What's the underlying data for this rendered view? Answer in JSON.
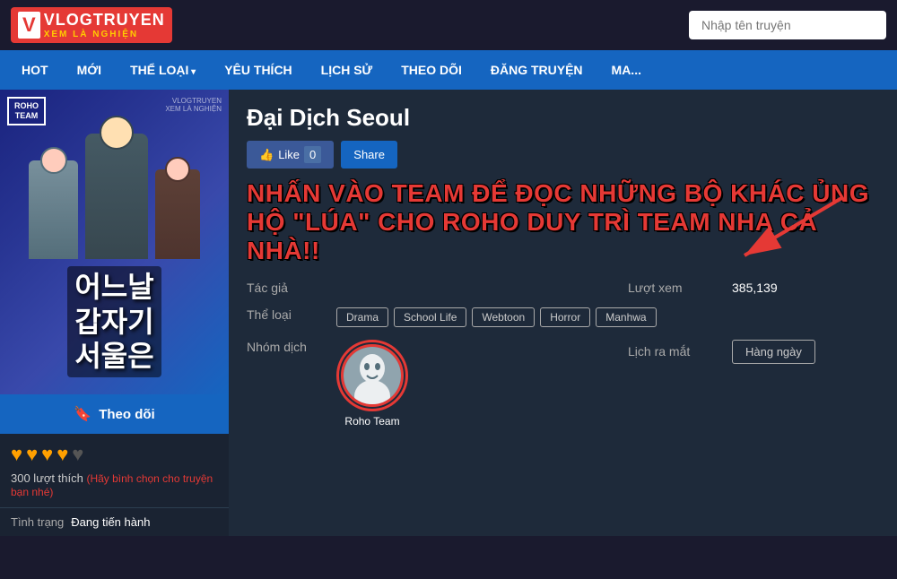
{
  "header": {
    "logo_v": "V",
    "logo_title": "VLOGTRUYEN",
    "logo_sub": "XEM LÀ NGHIỆN",
    "search_placeholder": "Nhập tên truyện"
  },
  "nav": {
    "items": [
      {
        "label": "HOT",
        "has_arrow": false
      },
      {
        "label": "MỚI",
        "has_arrow": false
      },
      {
        "label": "THỂ LOẠI",
        "has_arrow": true
      },
      {
        "label": "YÊU THÍCH",
        "has_arrow": false
      },
      {
        "label": "LỊCH SỬ",
        "has_arrow": false
      },
      {
        "label": "THEO DÕI",
        "has_arrow": false
      },
      {
        "label": "ĐĂNG TRUYỆN",
        "has_arrow": false
      },
      {
        "label": "MA...",
        "has_arrow": false
      }
    ]
  },
  "manga": {
    "cover_text_kr": "어느날\n갑자기\n서울은",
    "cover_badge_line1": "ROHO",
    "cover_badge_line2": "TEAM",
    "cover_watermark": "VLOGTRUYEN\nXEM LÀ NGHIỆN",
    "title": "Đại Dịch Seoul",
    "like_label": "Like",
    "like_count": "0",
    "share_label": "Share",
    "banner_text": "NHẤN VÀO TEAM ĐỂ ĐỌC NHỮNG BỘ KHÁC ỦNG HỘ \"LÚA\" CHO ROHO DUY TRÌ TEAM NHA CẢ NHÀ!!",
    "follow_label": "Theo dõi",
    "hearts": [
      "♥",
      "♥",
      "♥",
      "♥"
    ],
    "heart_empty": "♥",
    "rating_count": "300 lượt thích",
    "rating_vote_text": "(Hãy bình chọn cho truyện bạn nhé)",
    "status_label": "Tình trạng",
    "status_value": "Đang tiến hành",
    "info": {
      "tac_gia_label": "Tác giả",
      "tac_gia_value": "",
      "luot_xem_label": "Lượt xem",
      "luot_xem_value": "385,139",
      "the_loai_label": "Thể loại",
      "tags": [
        "Drama",
        "School Life",
        "Webtoon",
        "Horror",
        "Manhwa"
      ],
      "nhom_dich_label": "Nhóm dịch",
      "nhom_dich_name": "Roho Team",
      "lich_ra_mat_label": "Lịch ra mắt",
      "lich_ra_mat_value": "Hàng ngày"
    }
  }
}
